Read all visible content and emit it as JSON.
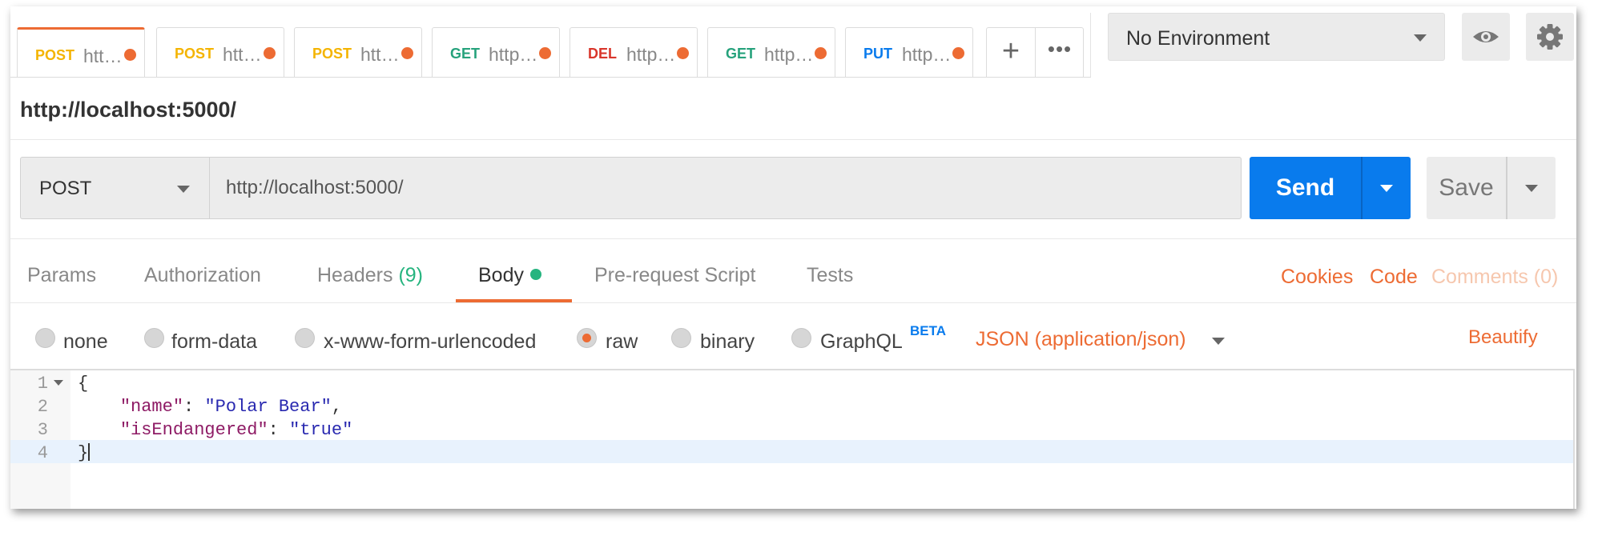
{
  "tabs": [
    {
      "method": "POST",
      "url": "htt…",
      "method_color": "#f4b400",
      "active": true
    },
    {
      "method": "POST",
      "url": "htt…",
      "method_color": "#f4b400",
      "active": false
    },
    {
      "method": "POST",
      "url": "htt…",
      "method_color": "#f4b400",
      "active": false
    },
    {
      "method": "GET",
      "url": "http…",
      "method_color": "#26a27c",
      "active": false
    },
    {
      "method": "DEL",
      "url": "http…",
      "method_color": "#d9362b",
      "active": false
    },
    {
      "method": "GET",
      "url": "http…",
      "method_color": "#26a27c",
      "active": false
    },
    {
      "method": "PUT",
      "url": "http…",
      "method_color": "#097bed",
      "active": false
    }
  ],
  "environment": {
    "selected": "No Environment"
  },
  "request": {
    "title": "http://localhost:5000/",
    "method": "POST",
    "url": "http://localhost:5000/",
    "send_label": "Send",
    "save_label": "Save"
  },
  "subtabs": {
    "params": "Params",
    "authorization": "Authorization",
    "headers": "Headers",
    "headers_count": "(9)",
    "body": "Body",
    "prerequest": "Pre-request Script",
    "tests": "Tests",
    "cookies": "Cookies",
    "code": "Code",
    "comments": "Comments (0)"
  },
  "body_modes": {
    "none": "none",
    "form_data": "form-data",
    "urlencoded": "x-www-form-urlencoded",
    "raw": "raw",
    "binary": "binary",
    "graphql": "GraphQL",
    "graphql_badge": "BETA",
    "selected": "raw"
  },
  "content_type": "JSON (application/json)",
  "beautify": "Beautify",
  "editor": {
    "line_numbers": [
      "1",
      "2",
      "3",
      "4"
    ],
    "open_brace": "{",
    "close_brace": "}",
    "fields": [
      {
        "key": "\"name\"",
        "value": "\"Polar Bear\"",
        "trailing": ","
      },
      {
        "key": "\"isEndangered\"",
        "value": "\"true\"",
        "trailing": ""
      }
    ],
    "colon": ": "
  },
  "colors": {
    "accent": "#ed6b33",
    "send": "#097bed",
    "success": "#26b47f"
  }
}
